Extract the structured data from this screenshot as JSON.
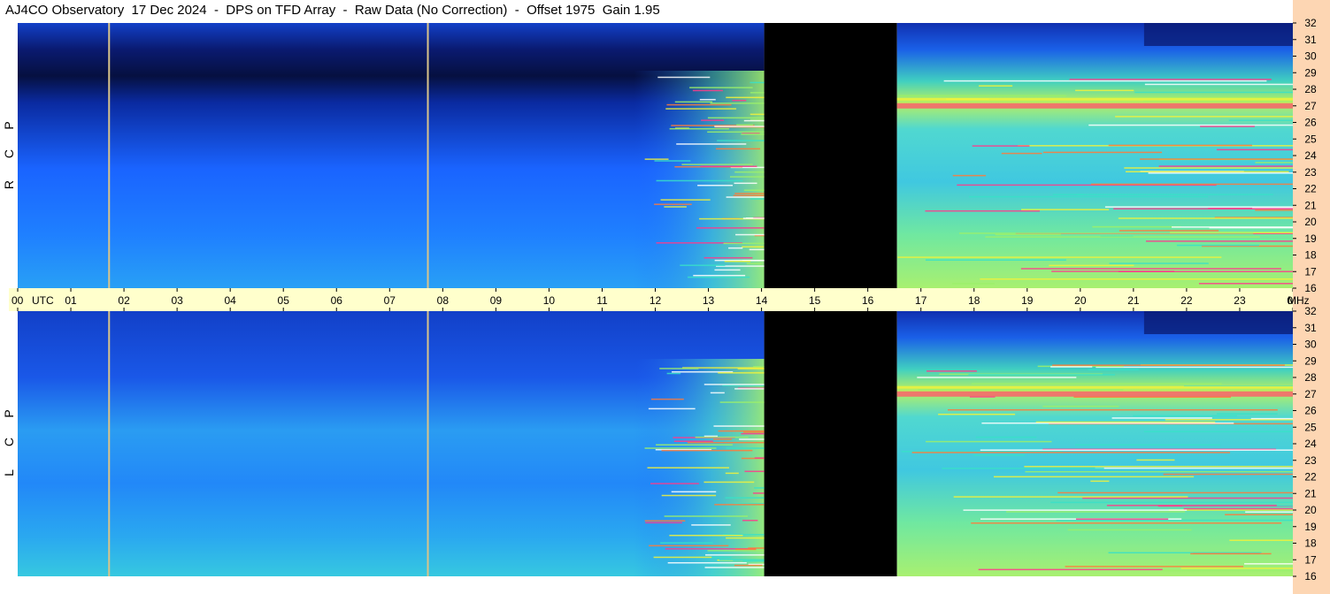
{
  "title": "AJ4CO Observatory  17 Dec 2024  -  DPS on TFD Array  -  Raw Data (No Correction)  -  Offset 1975  Gain 1.95",
  "panels": [
    {
      "label": "R C P",
      "letters": [
        "R",
        "C",
        "P"
      ]
    },
    {
      "label": "L C P",
      "letters": [
        "L",
        "C",
        "P"
      ]
    }
  ],
  "colors": {
    "background": "#ffffff",
    "time_axis_band": "#ffffcc",
    "freq_axis_band": "#fdd6b3",
    "cursor_line": "#d9c48a",
    "no_data": "#000000"
  },
  "chart_data": {
    "type": "heatmap",
    "title": "AJ4CO Observatory  17 Dec 2024  -  DPS on TFD Array  -  Raw Data (No Correction)  -  Offset 1975  Gain 1.95",
    "x_axis": {
      "unit": "UTC",
      "range_hours": [
        0,
        24
      ],
      "tick_labels": [
        "00",
        "01",
        "02",
        "03",
        "04",
        "05",
        "06",
        "07",
        "08",
        "09",
        "10",
        "11",
        "12",
        "13",
        "14",
        "15",
        "16",
        "17",
        "18",
        "19",
        "20",
        "21",
        "22",
        "23",
        "00"
      ]
    },
    "y_axis": {
      "unit": "MHz",
      "range": [
        16,
        32
      ],
      "tick_labels": [
        "16",
        "17",
        "18",
        "19",
        "20",
        "21",
        "22",
        "23",
        "24",
        "25",
        "26",
        "27",
        "28",
        "29",
        "30",
        "31",
        "32"
      ]
    },
    "panels": [
      "R C P",
      "L C P"
    ],
    "no_data_interval_utc_hours": [
      14.05,
      16.55
    ],
    "vertical_marker_lines_utc_hours": [
      1.72,
      7.72
    ],
    "intensity_scale": [
      "#000000",
      "#0a1f8c",
      "#1550ff",
      "#2aa8f0",
      "#38e0c8",
      "#9cf06a",
      "#f2f23a",
      "#ff7a3a",
      "#ff3a8c"
    ]
  }
}
